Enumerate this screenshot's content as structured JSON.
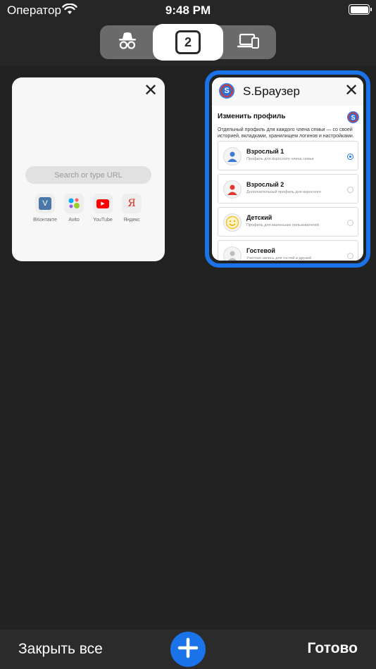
{
  "status_bar": {
    "carrier": "Оператор",
    "time": "9:48 PM"
  },
  "tab_switcher": {
    "tab_count": "2",
    "segments": [
      "incognito-icon",
      "tab-count",
      "devices-icon"
    ]
  },
  "tabs": [
    {
      "close_label": "✕",
      "search_placeholder": "Search or type URL",
      "quick_links": [
        {
          "label": "ВКонтакте",
          "glyph": "V",
          "color": "#4a76a8"
        },
        {
          "label": "Avito",
          "glyph": "",
          "color": "#00aaff"
        },
        {
          "label": "YouTube",
          "glyph": "▶",
          "color": "#ff0000"
        },
        {
          "label": "Яндекс",
          "glyph": "Я",
          "color": "#e0261b"
        }
      ]
    },
    {
      "close_label": "✕",
      "title": "S.Браузер",
      "logo_glyph": "S",
      "panel_title": "Изменить профиль",
      "panel_description": "Отдельный профиль для каждого члена семьи — со своей историей, вкладками, хранилищем логинов и настройками.",
      "profiles": [
        {
          "name": "Взрослый 1",
          "subtitle": "Профиль для взрослого члена семьи",
          "selected": true,
          "color": "#3b7bd6"
        },
        {
          "name": "Взрослый 2",
          "subtitle": "Дополнительный профиль для взрослого",
          "selected": false,
          "color": "#e03a2f"
        },
        {
          "name": "Детский",
          "subtitle": "Профиль для маленьких пользователей",
          "selected": false,
          "color": "#f2c22e"
        },
        {
          "name": "Гостевой",
          "subtitle": "Учетная запись для гостей и друзей",
          "selected": false,
          "color": "#bdbdbd"
        }
      ]
    }
  ],
  "bottom_bar": {
    "close_all": "Закрыть все",
    "done": "Готово"
  },
  "colors": {
    "accent": "#1a73e8",
    "background": "#262626"
  }
}
